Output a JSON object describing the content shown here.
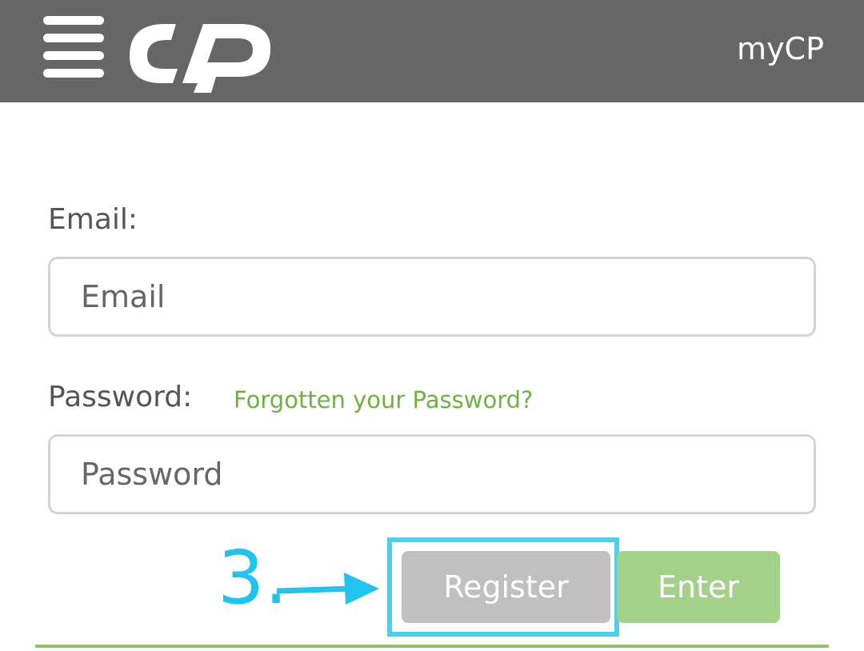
{
  "header": {
    "menu_icon": "hamburger-menu-icon",
    "logo_icon": "cp-logo-icon",
    "title": "myCP",
    "background_color": "#666666"
  },
  "form": {
    "email_label": "Email:",
    "email_placeholder": "Email",
    "email_value": "",
    "password_label": "Password:",
    "forgot_link": "Forgotten your Password?",
    "password_placeholder": "Password",
    "password_value": "",
    "register_label": "Register",
    "enter_label": "Enter"
  },
  "annotation": {
    "step": "3.",
    "arrow_icon": "right-arrow-icon",
    "color": "#21c4ef"
  },
  "colors": {
    "accent_green": "#6db33f",
    "enter_button": "#a3d18a",
    "register_button": "#c0c0c0"
  }
}
